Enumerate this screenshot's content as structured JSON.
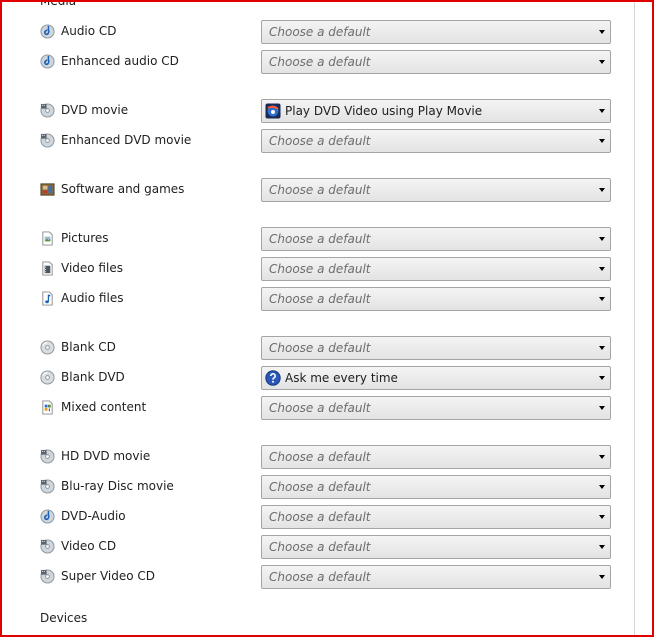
{
  "sections": {
    "media_heading": "Media",
    "devices_heading": "Devices"
  },
  "rows": [
    {
      "label": "Audio CD",
      "icon": "audio-cd-icon",
      "value": "Choose a default"
    },
    {
      "label": "Enhanced audio CD",
      "icon": "audio-cd-icon",
      "value": "Choose a default"
    },
    {
      "label": "DVD movie",
      "icon": "dvd-movie-icon",
      "value": "Play DVD Video using Play Movie",
      "value_icon": "play-movie-icon"
    },
    {
      "label": "Enhanced DVD movie",
      "icon": "dvd-movie-icon",
      "value": "Choose a default"
    },
    {
      "label": "Software and games",
      "icon": "software-games-icon",
      "value": "Choose a default"
    },
    {
      "label": "Pictures",
      "icon": "pictures-icon",
      "value": "Choose a default"
    },
    {
      "label": "Video files",
      "icon": "video-files-icon",
      "value": "Choose a default"
    },
    {
      "label": "Audio files",
      "icon": "audio-files-icon",
      "value": "Choose a default"
    },
    {
      "label": "Blank CD",
      "icon": "blank-cd-icon",
      "value": "Choose a default"
    },
    {
      "label": "Blank DVD",
      "icon": "blank-dvd-icon",
      "value": "Ask me every time",
      "value_icon": "question-icon"
    },
    {
      "label": "Mixed content",
      "icon": "mixed-content-icon",
      "value": "Choose a default"
    },
    {
      "label": "HD DVD movie",
      "icon": "hd-dvd-icon",
      "value": "Choose a default"
    },
    {
      "label": "Blu-ray Disc movie",
      "icon": "bluray-icon",
      "value": "Choose a default"
    },
    {
      "label": "DVD-Audio",
      "icon": "dvd-audio-icon",
      "value": "Choose a default"
    },
    {
      "label": "Video CD",
      "icon": "video-cd-icon",
      "value": "Choose a default"
    },
    {
      "label": "Super Video CD",
      "icon": "super-video-cd-icon",
      "value": "Choose a default"
    }
  ],
  "colors": {
    "frame_border": "#e00000",
    "placeholder_text": "#6d6d6d",
    "combo_border": "#a5a5a5"
  }
}
